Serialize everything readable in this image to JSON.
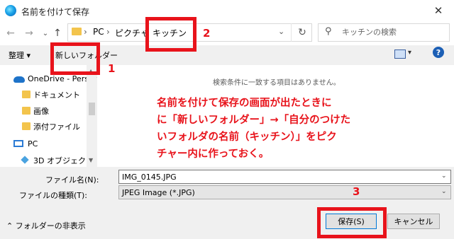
{
  "window": {
    "title": "名前を付けて保存"
  },
  "address": {
    "breadcrumbs": [
      "PC",
      "ピクチャ",
      "キッチン"
    ],
    "separator": "›",
    "search_placeholder": "キッチンの検索"
  },
  "toolbar": {
    "organize_label": "整理 ▾",
    "new_folder_label": "新しいフォルダー"
  },
  "nav_pane": {
    "items": [
      {
        "label": "OneDrive - Persor",
        "icon": "cloud-icon"
      },
      {
        "label": "ドキュメント",
        "icon": "folder-icon"
      },
      {
        "label": "画像",
        "icon": "folder-icon"
      },
      {
        "label": "添付ファイル",
        "icon": "folder-icon"
      },
      {
        "label": "PC",
        "icon": "pc-icon"
      },
      {
        "label": "3D オブジェクト",
        "icon": "cube-icon"
      }
    ]
  },
  "file_pane": {
    "empty_message": "検索条件に一致する項目はありません。",
    "annotation": "名前を付けて保存の画面が出たときに\nに「新しいフォルダー」→「自分のつけた\nいフォルダの名前（キッチン）」をピク\nチャー内に作っておく。"
  },
  "form": {
    "filename_label": "ファイル名(N):",
    "filename_value": "IMG_0145.JPG",
    "filetype_label": "ファイルの種類(T):",
    "filetype_value": "JPEG Image (*.JPG)"
  },
  "footer": {
    "hide_folders_label": "フォルダーの非表示",
    "save_label": "保存(S)",
    "cancel_label": "キャンセル"
  },
  "annotations": {
    "num1": "1",
    "num2": "2",
    "num3": "3"
  },
  "colors": {
    "annotation_red": "#e8131b",
    "accent_blue": "#0078d7",
    "folder_yellow": "#f3c44c"
  }
}
